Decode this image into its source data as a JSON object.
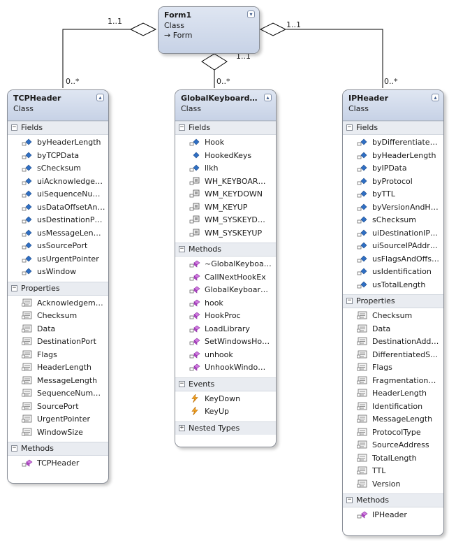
{
  "diagram": {
    "classes": {
      "form1": {
        "name": "Form1",
        "type": "Class",
        "base": "Form",
        "base_icon": "inherit-arrow-icon"
      },
      "tcpheader": {
        "name": "TCPHeader",
        "type": "Class",
        "sections": {
          "fields": {
            "label": "Fields",
            "items": [
              "byHeaderLength",
              "byTCPData",
              "sChecksum",
              "uiAcknowledge…",
              "uiSequenceNu…",
              "usDataOffsetAn…",
              "usDestinationP…",
              "usMessageLen…",
              "usSourcePort",
              "usUrgentPointer",
              "usWindow"
            ]
          },
          "properties": {
            "label": "Properties",
            "items": [
              "Acknowledgem…",
              "Checksum",
              "Data",
              "DestinationPort",
              "Flags",
              "HeaderLength",
              "MessageLength",
              "SequenceNum…",
              "SourcePort",
              "UrgentPointer",
              "WindowSize"
            ]
          },
          "methods": {
            "label": "Methods",
            "items": [
              "TCPHeader"
            ]
          }
        }
      },
      "globalkeyboard": {
        "name": "GlobalKeyboard…",
        "type": "Class",
        "sections": {
          "fields": {
            "label": "Fields",
            "items": [
              "Hook",
              "HookedKeys",
              "llkh",
              "WH_KEYBOAR…",
              "WM_KEYDOWN",
              "WM_KEYUP",
              "WM_SYSKEYD…",
              "WM_SYSKEYUP"
            ]
          },
          "methods": {
            "label": "Methods",
            "items": [
              "~GlobalKeyboa…",
              "CallNextHookEx",
              "GlobalKeyboar…",
              "hook",
              "HookProc",
              "LoadLibrary",
              "SetWindowsHo…",
              "unhook",
              "UnhookWindo…"
            ]
          },
          "events": {
            "label": "Events",
            "items": [
              "KeyDown",
              "KeyUp"
            ]
          },
          "nested_types": {
            "label": "Nested Types",
            "items": []
          }
        }
      },
      "ipheader": {
        "name": "IPHeader",
        "type": "Class",
        "sections": {
          "fields": {
            "label": "Fields",
            "items": [
              "byDifferentiate…",
              "byHeaderLength",
              "byIPData",
              "byProtocol",
              "byTTL",
              "byVersionAndH…",
              "sChecksum",
              "uiDestinationIP…",
              "uiSourceIPAddr…",
              "usFlagsAndOffs…",
              "usIdentification",
              "usTotalLength"
            ]
          },
          "properties": {
            "label": "Properties",
            "items": [
              "Checksum",
              "Data",
              "DestinationAdd…",
              "DifferentiatedS…",
              "Flags",
              "Fragmentation…",
              "HeaderLength",
              "Identification",
              "MessageLength",
              "ProtocolType",
              "SourceAddress",
              "TotalLength",
              "TTL",
              "Version"
            ]
          },
          "methods": {
            "label": "Methods",
            "items": [
              "IPHeader"
            ]
          }
        }
      }
    },
    "associations": {
      "form1_tcp": {
        "source_mult": "1..1",
        "target_mult": "0..*"
      },
      "form1_global": {
        "source_mult": "1..1",
        "target_mult": "0..*"
      },
      "form1_ip": {
        "source_mult": "1..1",
        "target_mult": "0..*"
      }
    },
    "icons": {
      "field": "field-icon",
      "static_field": "static-field-icon",
      "const": "constant-icon",
      "property": "property-icon",
      "method": "method-icon",
      "event": "event-icon",
      "collapse": "collapse-chevron-icon",
      "expand_section": "minus-toggle-icon",
      "collapsed_section": "plus-toggle-icon"
    },
    "colors": {
      "header_top": "#dfe6f2",
      "header_bottom": "#c7d2e6",
      "border": "#8a8f98",
      "section_bg": "#e9ecf1",
      "field_icon": "#2f6fc4",
      "method_icon": "#b34bc8",
      "event_icon": "#f0a020"
    }
  }
}
